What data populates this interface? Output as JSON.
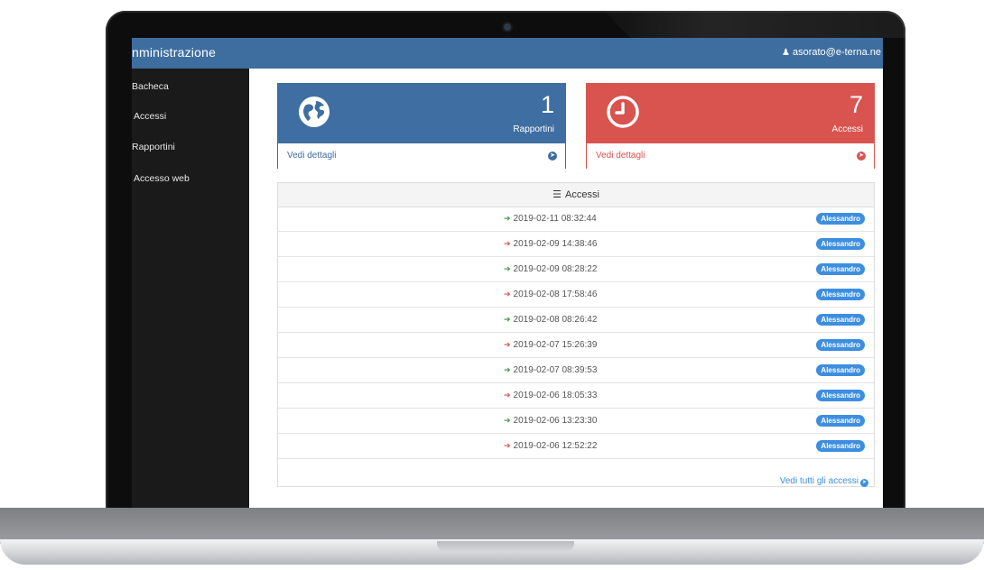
{
  "app": {
    "title": "nministrazione"
  },
  "header": {
    "user_email": "asorato@e-terna.ne"
  },
  "sidebar": {
    "items": [
      {
        "label": "Bacheca"
      },
      {
        "label": "Accessi"
      },
      {
        "label": "Rapportini"
      },
      {
        "label": "Accesso web"
      }
    ]
  },
  "cards": [
    {
      "count": "1",
      "label": "Rapportini",
      "link": "Vedi dettagli",
      "icon": "globe-icon",
      "color": "#3f6ea2"
    },
    {
      "count": "7",
      "label": "Accessi",
      "link": "Vedi dettagli",
      "icon": "clock-icon",
      "color": "#d9534f"
    }
  ],
  "accessi": {
    "title": "Accessi",
    "rows": [
      {
        "time": "2019-02-11 08:32:44",
        "type": "in",
        "user": "Alessandro"
      },
      {
        "time": "2019-02-09 14:38:46",
        "type": "out",
        "user": "Alessandro"
      },
      {
        "time": "2019-02-09 08:28:22",
        "type": "in",
        "user": "Alessandro"
      },
      {
        "time": "2019-02-08 17:58:46",
        "type": "out",
        "user": "Alessandro"
      },
      {
        "time": "2019-02-08 08:26:42",
        "type": "in",
        "user": "Alessandro"
      },
      {
        "time": "2019-02-07 15:26:39",
        "type": "out",
        "user": "Alessandro"
      },
      {
        "time": "2019-02-07 08:39:53",
        "type": "in",
        "user": "Alessandro"
      },
      {
        "time": "2019-02-06 18:05:33",
        "type": "out",
        "user": "Alessandro"
      },
      {
        "time": "2019-02-06 13:23:30",
        "type": "in",
        "user": "Alessandro"
      },
      {
        "time": "2019-02-06 12:52:22",
        "type": "out",
        "user": "Alessandro"
      }
    ],
    "view_all": "Vedi tutti gli accessi"
  },
  "colors": {
    "topbar": "#3e6ea0",
    "sidebar": "#1a1a1a",
    "badge": "#3e8ee0",
    "in": "#3c9a3c",
    "out": "#d9534f"
  }
}
